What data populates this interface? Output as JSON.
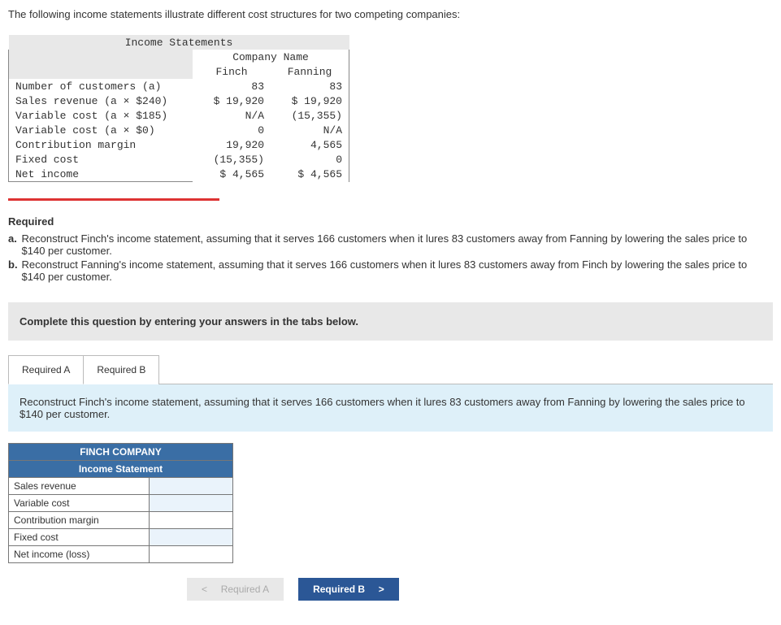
{
  "intro": "The following income statements illustrate different cost structures for two competing companies:",
  "statements": {
    "title": "Income Statements",
    "company_header": "Company Name",
    "companies": [
      "Finch",
      "Fanning"
    ],
    "rows": {
      "customers": {
        "label": "Number of customers (a)",
        "finch": "83",
        "fanning": "83"
      },
      "sales": {
        "label": "Sales revenue (a × $240)",
        "finch": "$ 19,920",
        "fanning": "$ 19,920"
      },
      "vc185": {
        "label": "Variable cost (a × $185)",
        "finch": "N/A",
        "fanning": "(15,355)"
      },
      "vc0": {
        "label": "Variable cost (a × $0)",
        "finch": "0",
        "fanning": "N/A"
      },
      "cm": {
        "label": "Contribution margin",
        "finch": "19,920",
        "fanning": "4,565"
      },
      "fixed": {
        "label": "Fixed cost",
        "finch": "(15,355)",
        "fanning": "0"
      },
      "net": {
        "label": "Net income",
        "finch": "$  4,565",
        "fanning": "$  4,565"
      }
    }
  },
  "required": {
    "heading": "Required",
    "a": "Reconstruct Finch's income statement, assuming that it serves 166 customers when it lures 83 customers away from Fanning by lowering the sales price to $140 per customer.",
    "b": "Reconstruct Fanning's income statement, assuming that it serves 166 customers when it lures 83 customers away from Finch by lowering the sales price to $140 per customer."
  },
  "instruct": "Complete this question by entering your answers in the tabs below.",
  "tabs": {
    "a": "Required A",
    "b": "Required B"
  },
  "panel_text": "Reconstruct Finch's income statement, assuming that it serves 166 customers when it lures 83 customers away from Fanning by lowering the sales price to $140 per customer.",
  "answer_table": {
    "title1": "FINCH COMPANY",
    "title2": "Income Statement",
    "rows": [
      "Sales revenue",
      "Variable cost",
      "Contribution margin",
      "Fixed cost",
      "Net income (loss)"
    ]
  },
  "nav": {
    "prev": "Required A",
    "next": "Required B"
  },
  "glyph": {
    "lt": "<",
    "gt": ">"
  }
}
